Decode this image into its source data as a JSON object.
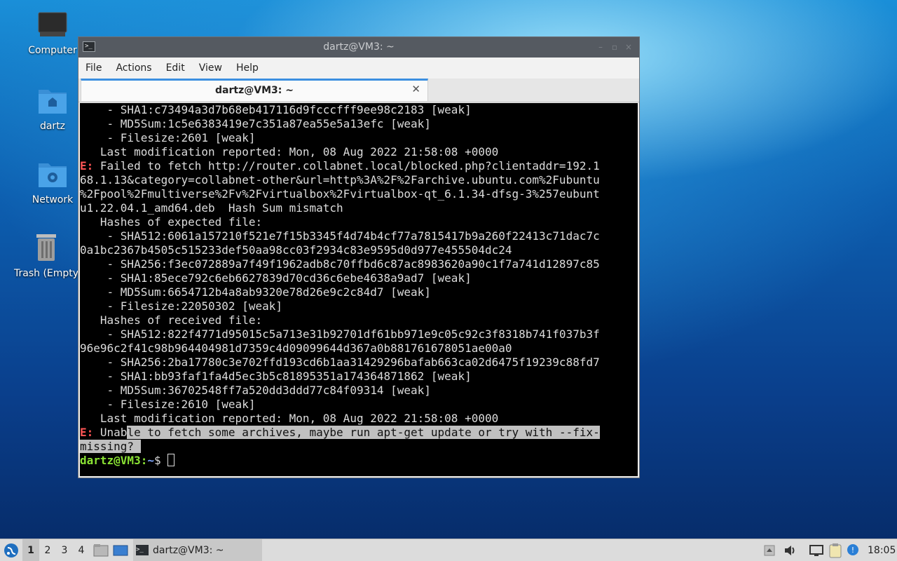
{
  "desktop": {
    "icons": [
      {
        "label": "Computer"
      },
      {
        "label": "dartz"
      },
      {
        "label": "Network"
      },
      {
        "label": "Trash (Empty)"
      }
    ]
  },
  "window": {
    "title": "dartz@VM3: ~",
    "menu": [
      "File",
      "Actions",
      "Edit",
      "View",
      "Help"
    ],
    "tab_title": "dartz@VM3: ~"
  },
  "terminal": {
    "lines": [
      "    - SHA1:c73494a3d7b68eb417116d9fcccfff9ee98c2183 [weak]",
      "    - MD5Sum:1c5e6383419e7c351a87ea55e5a13efc [weak]",
      "    - Filesize:2601 [weak]",
      "   Last modification reported: Mon, 08 Aug 2022 21:58:08 +0000",
      " Failed to fetch http://router.collabnet.local/blocked.php?clientaddr=192.1",
      "68.1.13&category=collabnet-other&url=http%3A%2F%2Farchive.ubuntu.com%2Fubuntu",
      "%2Fpool%2Fmultiverse%2Fv%2Fvirtualbox%2Fvirtualbox-qt_6.1.34-dfsg-3%257eubunt",
      "u1.22.04.1_amd64.deb  Hash Sum mismatch",
      "   Hashes of expected file:",
      "    - SHA512:6061a157210f521e7f15b3345f4d74b4cf77a7815417b9a260f22413c71dac7c",
      "0a1bc2367b4505c515233def50aa98cc03f2934c83e9595d0d977e455504dc24",
      "    - SHA256:f3ec072889a7f49f1962adb8c70ffbd6c87ac8983620a90c1f7a741d12897c85",
      "    - SHA1:85ece792c6eb6627839d70cd36c6ebe4638a9ad7 [weak]",
      "    - MD5Sum:6654712b4a8ab9320e78d26e9c2c84d7 [weak]",
      "    - Filesize:22050302 [weak]",
      "   Hashes of received file:",
      "    - SHA512:822f4771d95015c5a713e31b92701df61bb971e9c05c92c3f8318b741f037b3f",
      "96e96c2f41c98b964404981d7359c4d09099644d367a0b881761678051ae00a0",
      "    - SHA256:2ba17780c3e702ffd193cd6b1aa31429296bafab663ca02d6475f19239c88fd7",
      "    - SHA1:bb93faf1fa4d5ec3b5c81895351a174364871862 [weak]",
      "    - MD5Sum:36702548ff7a520dd3ddd77c84f09314 [weak]",
      "    - Filesize:2610 [weak]",
      "   Last modification reported: Mon, 08 Aug 2022 21:58:08 +0000"
    ],
    "error_prefix": "E:",
    "final_error_unselected": " Unab",
    "final_error_selected_1": "le to fetch some archives, maybe run apt-get update or try with --fix-",
    "final_error_selected_2": "missing? ",
    "prompt_user": "dartz@VM3:",
    "prompt_path": "~",
    "prompt_symbol": "$ "
  },
  "taskbar": {
    "workspaces": [
      "1",
      "2",
      "3",
      "4"
    ],
    "active_workspace": "1",
    "task_label": "dartz@VM3: ~",
    "clock": "18:05"
  },
  "colors": {
    "error": "#ff5555",
    "prompt_user": "#8ae234",
    "prompt_path": "#7fa6ff",
    "tab_accent": "#3c8fe0"
  }
}
